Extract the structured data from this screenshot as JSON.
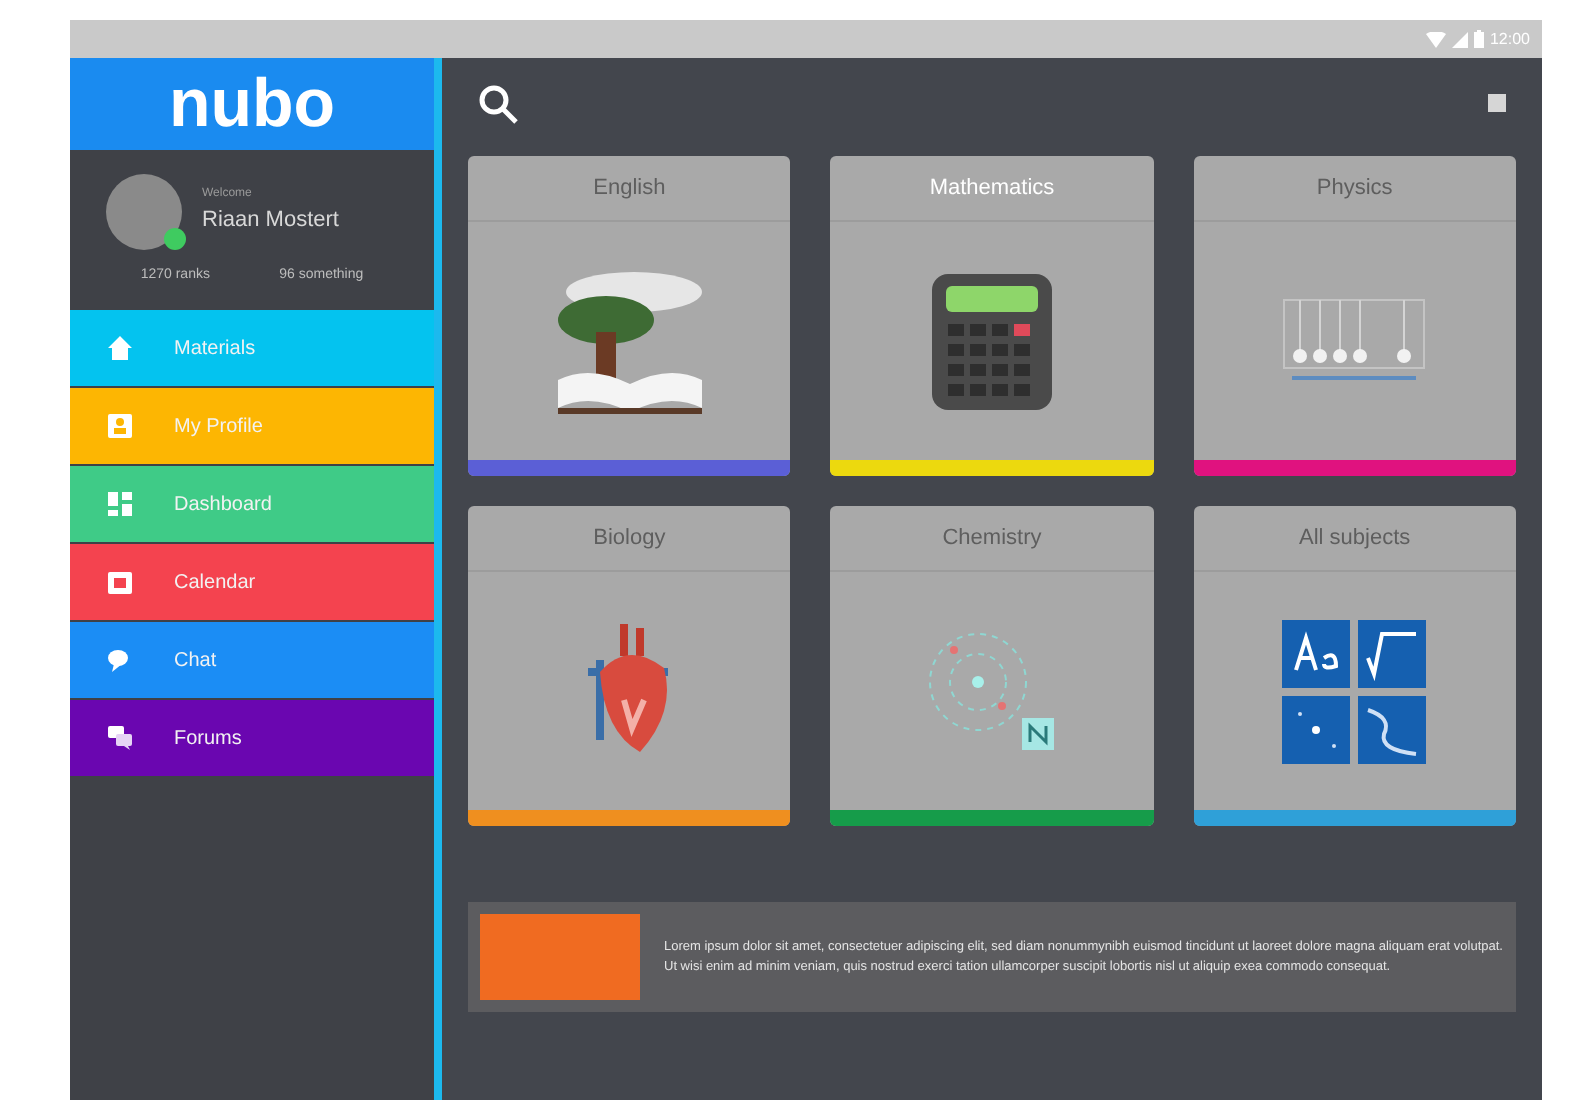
{
  "status_bar": {
    "time": "12:00"
  },
  "logo": "nubo",
  "profile": {
    "greeting": "Welcome",
    "name": "Riaan Mostert",
    "online": true,
    "stats": [
      "1270 ranks",
      "96 something"
    ]
  },
  "nav": [
    {
      "label": "Materials",
      "kind": "home",
      "color": "#04c3ef"
    },
    {
      "label": "My Profile",
      "kind": "profile",
      "color": "#fdb602"
    },
    {
      "label": "Dashboard",
      "kind": "dashboard",
      "color": "#3fcb87"
    },
    {
      "label": "Calendar",
      "kind": "calendar",
      "color": "#f4434f"
    },
    {
      "label": "Chat",
      "kind": "chat",
      "color": "#1b8df5"
    },
    {
      "label": "Forums",
      "kind": "forum",
      "color": "#6a06b0"
    }
  ],
  "subjects": [
    {
      "title": "English",
      "kind": "book",
      "color": "#5b5fd6",
      "selected": false
    },
    {
      "title": "Mathematics",
      "kind": "calculator",
      "color": "#ecd90e",
      "selected": true
    },
    {
      "title": "Physics",
      "kind": "pendulum",
      "color": "#e0127f",
      "selected": false
    },
    {
      "title": "Biology",
      "kind": "heart",
      "color": "#ef8f1f",
      "selected": false
    },
    {
      "title": "Chemistry",
      "kind": "atom",
      "color": "#169c4a",
      "selected": false
    },
    {
      "title": "All subjects",
      "kind": "grid",
      "color": "#2fa0d8",
      "selected": false
    }
  ],
  "banner": {
    "text": "Lorem ipsum dolor sit amet, consectetuer adipiscing elit, sed diam nonummynibh euismod tincidunt ut laoreet dolore magna aliquam erat volutpat. Ut wisi enim ad minim veniam, quis nostrud exerci tation ullamcorper suscipit lobortis nisl ut aliquip exea commodo consequat."
  }
}
